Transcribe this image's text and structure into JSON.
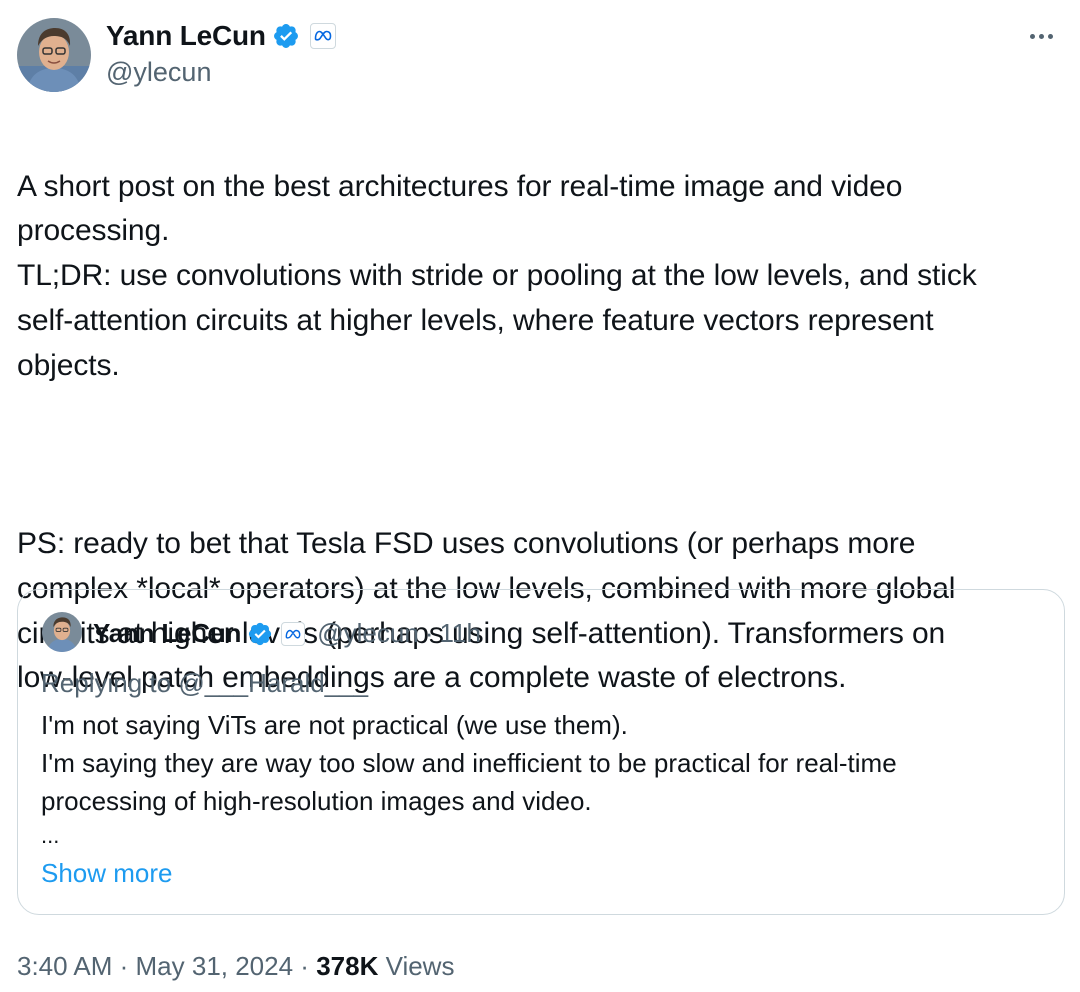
{
  "author": {
    "name": "Yann LeCun",
    "handle": "@ylecun",
    "avatar_icon": "person-avatar",
    "verified_icon": "verified-badge-icon",
    "affiliation_icon": "meta-logo-icon"
  },
  "tweet": {
    "paragraphs": [
      "A short post on the best architectures for real-time image and video\nprocessing.\nTL;DR: use convolutions with stride or pooling at the low levels, and stick\nself-attention circuits at higher levels, where feature vectors represent\nobjects.",
      "PS: ready to bet that Tesla FSD uses convolutions (or perhaps more\ncomplex *local* operators) at the low levels, combined with more global\ncircuits at higher levels (perhaps using self-attention). Transformers on\nlow-level patch embeddings are a complete waste of electrons."
    ]
  },
  "quote": {
    "name": "Yann LeCun",
    "handle": "@ylecun",
    "separator": "·",
    "time": "11h",
    "replying_prefix": "Replying to ",
    "replying_to": "@___Harald___",
    "body_lines": [
      "I'm not saying ViTs are not practical (we use them).",
      "I'm saying they are way too slow and inefficient to be practical for real-time",
      "processing of high-resolution images and video."
    ],
    "ellipsis": "...",
    "show_more": "Show more"
  },
  "meta": {
    "time": "3:40 AM",
    "sep1": " · ",
    "date": "May 31, 2024",
    "sep2": " · ",
    "views_count": "378K",
    "views_label": " Views"
  },
  "colors": {
    "text": "#0f1419",
    "secondary": "#536471",
    "link": "#1d9bf0",
    "verified": "#1d9bf0",
    "border": "#cfd9de"
  }
}
